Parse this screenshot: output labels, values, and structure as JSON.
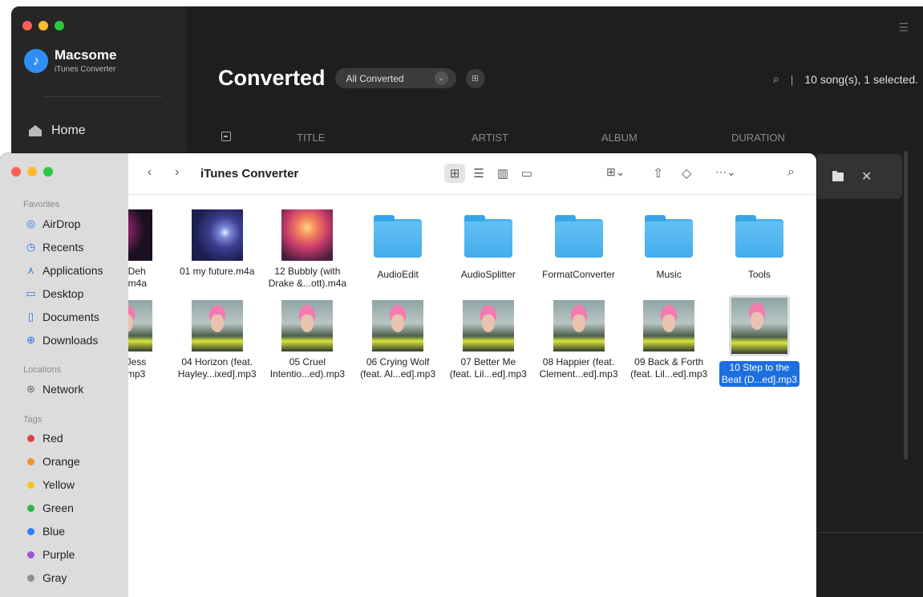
{
  "app": {
    "brand_name": "Macsome",
    "brand_sub": "iTunes Converter",
    "home_label": "Home",
    "page_title": "Converted",
    "filter_label": "All Converted",
    "status_sep": "|",
    "status_text": "10 song(s), 1 selected.",
    "columns": [
      "TITLE",
      "ARTIST",
      "ALBUM",
      "DURATION"
    ]
  },
  "finder": {
    "window_title": "iTunes Converter",
    "favorites_header": "Favorites",
    "favorites": [
      {
        "label": "AirDrop",
        "icon": "airdrop-icon"
      },
      {
        "label": "Recents",
        "icon": "clock-icon"
      },
      {
        "label": "Applications",
        "icon": "applications-icon"
      },
      {
        "label": "Desktop",
        "icon": "desktop-icon"
      },
      {
        "label": "Documents",
        "icon": "document-icon"
      },
      {
        "label": "Downloads",
        "icon": "download-icon"
      }
    ],
    "locations_header": "Locations",
    "locations": [
      {
        "label": "Network",
        "icon": "network-icon"
      }
    ],
    "tags_header": "Tags",
    "tags": [
      {
        "label": "Red",
        "color": "#e5413b"
      },
      {
        "label": "Orange",
        "color": "#f0922e"
      },
      {
        "label": "Yellow",
        "color": "#f3c418"
      },
      {
        "label": "Green",
        "color": "#35b34a"
      },
      {
        "label": "Blue",
        "color": "#2d7df6"
      },
      {
        "label": "Purple",
        "color": "#a452d8"
      },
      {
        "label": "Gray",
        "color": "#8e8e93"
      }
    ],
    "row1": [
      {
        "line1": "own Deh",
        "line2": "...ul).m4a",
        "kind": "art-a"
      },
      {
        "line1": "01 my future.m4a",
        "line2": "",
        "kind": "art-b"
      },
      {
        "line1": "12 Bubbly (with",
        "line2": "Drake &...ott).m4a",
        "kind": "art-c"
      },
      {
        "line1": "AudioEdit",
        "line2": "",
        "kind": "folder"
      },
      {
        "line1": "AudioSplitter",
        "line2": "",
        "kind": "folder"
      },
      {
        "line1": "FormatConverter",
        "line2": "",
        "kind": "folder"
      },
      {
        "line1": "Music",
        "line2": "",
        "kind": "folder"
      },
      {
        "line1": "Tools",
        "line2": "",
        "kind": "folder"
      }
    ],
    "row2": [
      {
        "line1": "rom Jess",
        "line2": "...d].mp3"
      },
      {
        "line1": "04 Horizon (feat.",
        "line2": "Hayley...ixed].mp3"
      },
      {
        "line1": "05 Cruel",
        "line2": "Intentio...ed).mp3"
      },
      {
        "line1": "06 Crying Wolf",
        "line2": "(feat. Al...ed].mp3"
      },
      {
        "line1": "07 Better Me",
        "line2": "(feat. Lil...ed].mp3"
      },
      {
        "line1": "08 Happier (feat.",
        "line2": "Clement...ed].mp3"
      },
      {
        "line1": "09 Back & Forth",
        "line2": "(feat. Lil...ed].mp3"
      },
      {
        "line1": "10 Step to the",
        "line2": "Beat (D...ed].mp3",
        "selected": true
      }
    ]
  }
}
